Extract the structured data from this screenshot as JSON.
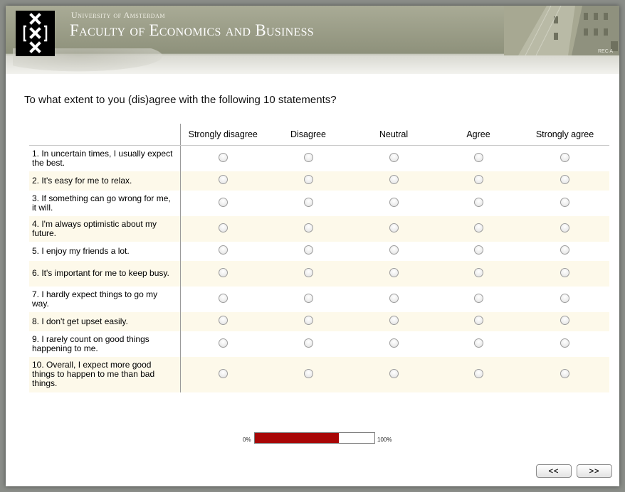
{
  "header": {
    "university": "University of Amsterdam",
    "faculty": "Faculty of Economics and Business",
    "logo_icon": "uva-crosses-logo-icon",
    "building_sign": "REC A"
  },
  "question": "To what extent to you (dis)agree with the following 10 statements?",
  "columns": [
    "Strongly disagree",
    "Disagree",
    "Neutral",
    "Agree",
    "Strongly agree"
  ],
  "statements": [
    "1. In uncertain times, I usually expect the best.",
    "2. It's easy for me to relax.",
    "3. If something can go wrong for me, it will.",
    "4. I'm always optimistic about my future.",
    "5. I enjoy my friends a lot.",
    "6. It's important for me to keep busy.",
    "7. I hardly expect things to go my way.",
    "8. I don't get upset easily.",
    "9. I rarely count on good things happening to me.",
    "10. Overall, I expect more good things to happen to me than bad things."
  ],
  "progress": {
    "low_label": "0%",
    "high_label": "100%",
    "fraction": 0.7,
    "fill_color": "#a80606"
  },
  "nav": {
    "back_label": "<<",
    "next_label": ">>"
  },
  "colors": {
    "row_alt_background": "#fdf9ea",
    "header_olive": "#8e917b"
  }
}
